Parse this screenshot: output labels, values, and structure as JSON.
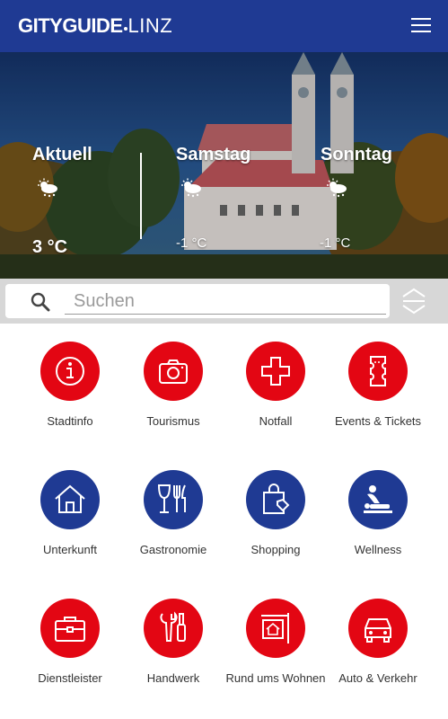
{
  "header": {
    "brand": "GITYGUIDE",
    "city": "LINZ",
    "menu_icon": "hamburger-menu-icon"
  },
  "weather": [
    {
      "day": "Aktuell",
      "temp": "3 °C",
      "icon": "cloud-sun-snow-icon"
    },
    {
      "day": "Samstag",
      "temp": "-1 °C",
      "icon": "cloud-sun-snow-icon"
    },
    {
      "day": "Sonntag",
      "temp": "-1 °C",
      "icon": "cloud-sun-snow-icon"
    }
  ],
  "search": {
    "placeholder": "Suchen",
    "value": "",
    "toggle_icon": "expand-collapse-icon"
  },
  "categories": [
    {
      "label": "Stadtinfo",
      "icon": "info-icon",
      "color": "#e30613"
    },
    {
      "label": "Tourismus",
      "icon": "camera-icon",
      "color": "#e30613"
    },
    {
      "label": "Notfall",
      "icon": "cross-icon",
      "color": "#e30613"
    },
    {
      "label": "Events & Tickets",
      "icon": "ticket-icon",
      "color": "#e30613"
    },
    {
      "label": "Unterkunft",
      "icon": "house-icon",
      "color": "#1f3a93"
    },
    {
      "label": "Gastronomie",
      "icon": "wine-cutlery-icon",
      "color": "#1f3a93"
    },
    {
      "label": "Shopping",
      "icon": "shopping-bag-icon",
      "color": "#1f3a93"
    },
    {
      "label": "Wellness",
      "icon": "massage-icon",
      "color": "#1f3a93"
    },
    {
      "label": "Dienstleister",
      "icon": "briefcase-icon",
      "color": "#e30613"
    },
    {
      "label": "Handwerk",
      "icon": "tools-icon",
      "color": "#e30613"
    },
    {
      "label": "Rund ums Wohnen",
      "icon": "house-sign-icon",
      "color": "#e30613"
    },
    {
      "label": "Auto & Verkehr",
      "icon": "car-icon",
      "color": "#e30613"
    }
  ]
}
